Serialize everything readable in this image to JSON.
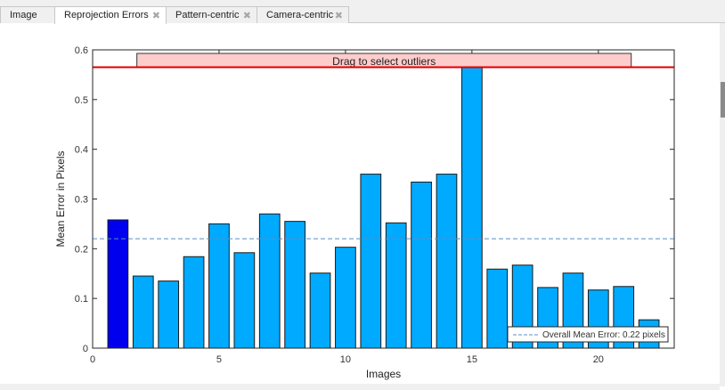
{
  "tabs": [
    {
      "label": "Image",
      "closable": false,
      "active": false
    },
    {
      "label": "Reprojection Errors",
      "closable": true,
      "active": true
    },
    {
      "label": "Pattern-centric",
      "closable": true,
      "active": false
    },
    {
      "label": "Camera-centric",
      "closable": true,
      "active": false
    }
  ],
  "colors": {
    "bar": "#00aaff",
    "selected_bar": "#0000ee",
    "mean_line": "#5a8fc8",
    "threshold_line": "#dd0000",
    "outlier_box": "#ffcccc"
  },
  "chart_data": {
    "type": "bar",
    "xlabel": "Images",
    "ylabel": "Mean Error in Pixels",
    "xlim": [
      0,
      23
    ],
    "ylim": [
      0,
      0.6
    ],
    "xticks": [
      0,
      5,
      10,
      15,
      20
    ],
    "yticks": [
      0,
      0.1,
      0.2,
      0.3,
      0.4,
      0.5,
      0.6
    ],
    "x": [
      1,
      2,
      3,
      4,
      5,
      6,
      7,
      8,
      9,
      10,
      11,
      12,
      13,
      14,
      15,
      16,
      17,
      18,
      19,
      20,
      21,
      22
    ],
    "values": [
      0.258,
      0.145,
      0.135,
      0.184,
      0.25,
      0.192,
      0.27,
      0.255,
      0.151,
      0.203,
      0.35,
      0.252,
      0.334,
      0.35,
      0.565,
      0.159,
      0.167,
      0.122,
      0.151,
      0.117,
      0.124,
      0.057
    ],
    "selected_index": 0,
    "mean_error": 0.22,
    "outlier_threshold": 0.565,
    "outlier_label": "Drag to select outliers",
    "legend": {
      "text": "Overall Mean Error: 0.22 pixels",
      "placement": "bottom-right"
    }
  }
}
